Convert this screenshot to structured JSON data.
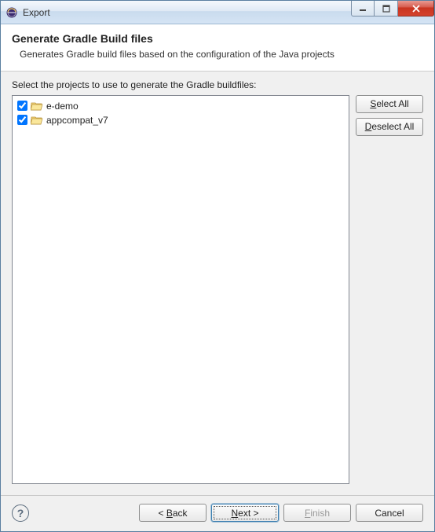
{
  "window": {
    "title": "Export"
  },
  "header": {
    "title": "Generate Gradle Build files",
    "description": "Generates Gradle build files based on the configuration of the Java projects"
  },
  "main": {
    "instruction": "Select the projects to use to generate the Gradle buildfiles:",
    "projects": [
      {
        "name": "e-demo",
        "checked": true
      },
      {
        "name": "appcompat_v7",
        "checked": true
      }
    ]
  },
  "sideButtons": {
    "selectAll": "Select All",
    "deselectAll": "Deselect All"
  },
  "wizard": {
    "back": "< Back",
    "next": "Next >",
    "finish": "Finish",
    "cancel": "Cancel"
  }
}
